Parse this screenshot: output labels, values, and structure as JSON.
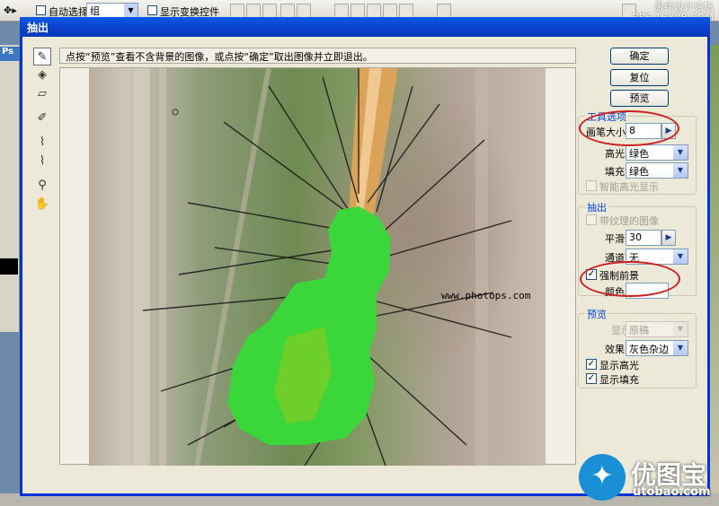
{
  "app_bar": {
    "auto_select_label": "自动选择:",
    "auto_select_value": "组",
    "show_transform_label": "显示变换控件",
    "watermark_line1": "思缘设计论坛",
    "watermark_line2": "BBS.16XX8.COM",
    "ps_logo": "Ps"
  },
  "dialog": {
    "title": "抽出",
    "instruction": "点按“预览”查看不含背景的图像，或点按“确定”取出图像并立即退出。",
    "watermark_url": "www.photops.com",
    "buttons": {
      "ok": "确定",
      "reset": "复位",
      "preview": "预览"
    },
    "tool_options": {
      "title": "工具选项",
      "brush_size_label": "画笔大小:",
      "brush_size_value": "8",
      "highlight_label": "高光:",
      "highlight_value": "绿色",
      "fill_label": "填充:",
      "fill_value": "绿色",
      "smart_highlight_label": "智能高光显示",
      "smart_highlight_checked": false
    },
    "extraction": {
      "title": "抽出",
      "textured_label": "带纹理的图像",
      "textured_checked": false,
      "smooth_label": "平滑:",
      "smooth_value": "30",
      "channel_label": "通道:",
      "channel_value": "无",
      "force_foreground_label": "强制前景",
      "force_foreground_checked": true,
      "color_label": "颜色:",
      "color_value": ""
    },
    "preview": {
      "title": "预览",
      "show_label": "显示",
      "show_value": "原稿",
      "effect_label": "效果:",
      "effect_value": "灰色杂边",
      "show_highlight_label": "显示高光",
      "show_highlight_checked": true,
      "show_fill_label": "显示填充",
      "show_fill_checked": true
    }
  },
  "branding": {
    "logo_name": "优图宝",
    "logo_url": "utobao.com"
  },
  "colors": {
    "title_bar": "#0c3fc9",
    "dialog_bg": "#ece9d8",
    "highlight_green": "#3ad63a",
    "annotation_ring": "#cc1f1f"
  }
}
